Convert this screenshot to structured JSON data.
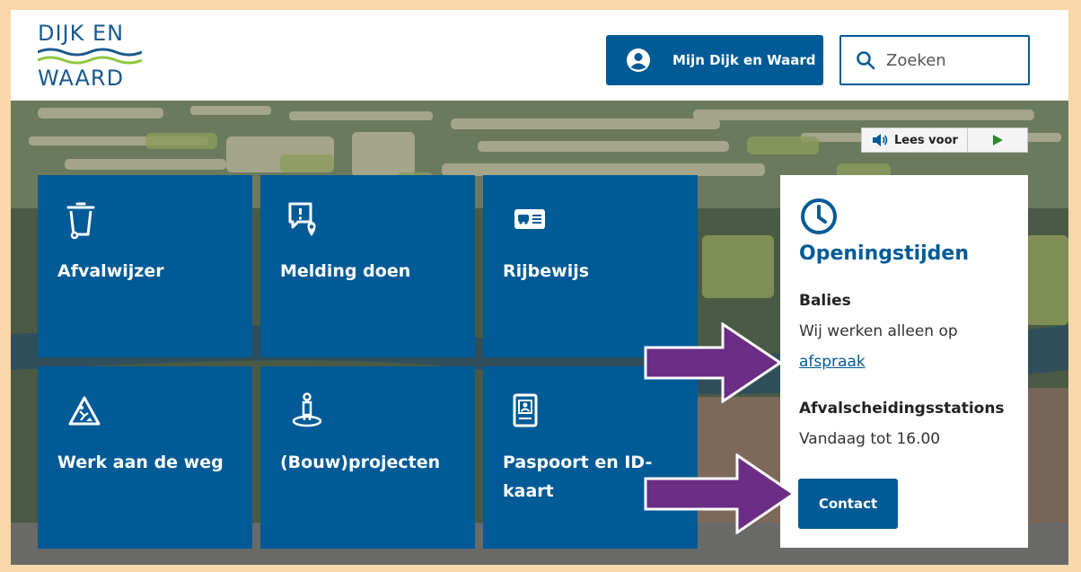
{
  "colors": {
    "brand_blue": "#005a96",
    "logo_blue": "#1a5a8e",
    "logo_green": "#8dc63f",
    "arrow_purple": "#6c2d85",
    "frame": "#f8d7a8"
  },
  "logo": {
    "line1": "DIJK EN",
    "line2": "WAARD"
  },
  "header": {
    "mijn_button": {
      "label": "Mijn Dijk en Waard",
      "icon": "account-circle-icon"
    },
    "search": {
      "placeholder": "Zoeken",
      "icon": "search-icon"
    }
  },
  "lees_voor": {
    "label": "Lees voor",
    "icon": "speaker-icon",
    "play_icon": "play-icon"
  },
  "tiles": [
    {
      "label": "Afvalwijzer",
      "icon": "waste-bin-icon"
    },
    {
      "label": "Melding doen",
      "icon": "report-location-icon"
    },
    {
      "label": "Rijbewijs",
      "icon": "driving-license-icon"
    },
    {
      "label": "Werk aan de weg",
      "icon": "road-works-icon"
    },
    {
      "label": "(Bouw)projecten",
      "icon": "construction-project-icon"
    },
    {
      "label": "Paspoort en ID-kaart",
      "icon": "passport-icon"
    }
  ],
  "openingstijden": {
    "icon": "clock-icon",
    "title": "Openingstijden",
    "balies_heading": "Balies",
    "balies_text": "Wij werken alleen op",
    "balies_link": "afspraak",
    "afval_heading": "Afvalscheidingsstations",
    "afval_text": "Vandaag tot 16.00",
    "contact_button": "Contact"
  },
  "annotations": [
    "arrow-to-afspraak",
    "arrow-to-contact"
  ]
}
